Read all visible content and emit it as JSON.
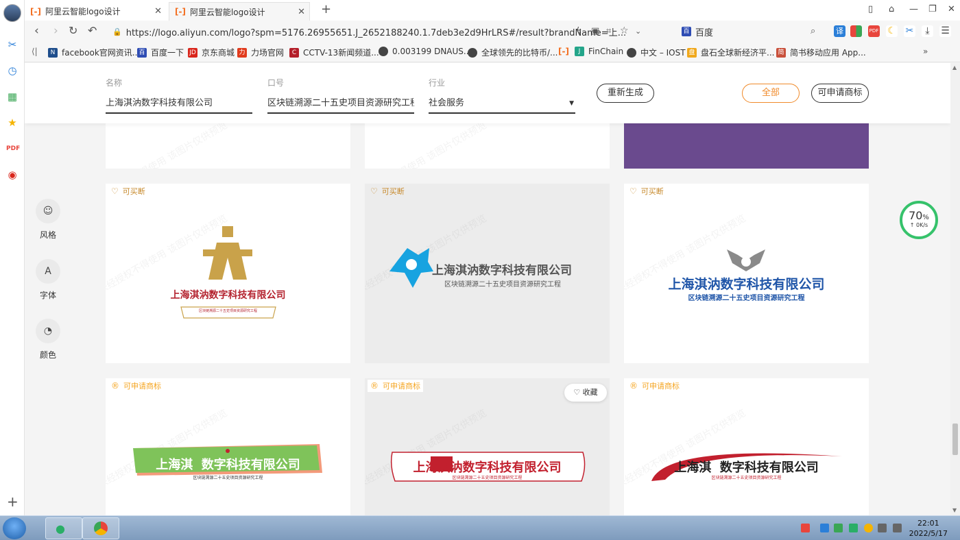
{
  "browser": {
    "tabs": [
      {
        "icon": "[-]",
        "title": "阿里云智能logo设计",
        "active": false
      },
      {
        "icon": "[-]",
        "title": "阿里云智能logo设计",
        "active": true
      }
    ],
    "url": "https://logo.aliyun.com/logo?spm=5176.26955651.J_2652188240.1.7deb3e2d9HrLRS#/result?brandName=上...",
    "search_engine": "百度",
    "bookmarks": [
      {
        "label": "facebook官网资讯...",
        "color": "#1f4e8c",
        "glyph": "N"
      },
      {
        "label": "百度一下",
        "color": "#2f4db4",
        "glyph": "百"
      },
      {
        "label": "京东商城",
        "color": "#d9261c",
        "glyph": "JD"
      },
      {
        "label": "力场官网",
        "color": "#e13b1d",
        "glyph": "力"
      },
      {
        "label": "CCTV-13新闻频道...",
        "color": "#b41f2a",
        "glyph": "C"
      },
      {
        "label": "0.003199 DNAUS...",
        "color": "#444444",
        "glyph": "●"
      },
      {
        "label": "全球领先的比特币/...",
        "color": "#444444",
        "glyph": "●"
      },
      {
        "label": "",
        "color": "#f36f21",
        "glyph": "[-]"
      },
      {
        "label": "FinChain",
        "color": "#24a58a",
        "glyph": "J"
      },
      {
        "label": "中文 – IOST",
        "color": "#444444",
        "glyph": "●"
      },
      {
        "label": "盘石全球新经济平...",
        "color": "#f0a81c",
        "glyph": "盘"
      },
      {
        "label": "简书移动应用 App...",
        "color": "#c9513c",
        "glyph": "简"
      }
    ]
  },
  "form": {
    "name_label": "名称",
    "name_value": "上海淇汭数字科技有限公司",
    "slogan_label": "口号",
    "slogan_value": "区块链溯源二十五史项目资源研究工程",
    "industry_label": "行业",
    "industry_value": "社会服务",
    "regenerate_label": "重新生成",
    "all_label": "全部",
    "registrable_label": "可申请商标"
  },
  "tools": [
    {
      "label": "风格",
      "glyph": "☺"
    },
    {
      "label": "字体",
      "glyph": "A"
    },
    {
      "label": "颜色",
      "glyph": "◔"
    }
  ],
  "badges": {
    "buyout": "可买断",
    "trademark": "可申请商标"
  },
  "favorite_label": "收藏",
  "watermark": "未经授权不得使用 该图片仅供预览",
  "logos": {
    "company": "上海淇汭数字科技有限公司",
    "slogan": "区块链溯源二十五史项目资源研究工程",
    "company_gap": "上海淇  数字科技有限公司",
    "colors": {
      "red": "#b4232f",
      "blue": "#1f55a8",
      "cyan": "#17a3e0",
      "gold": "#c9a24a",
      "green": "#7fc35a",
      "salmon": "#f39a7a",
      "darkred": "#c2202e"
    }
  },
  "speed_widget": {
    "percent": "70",
    "unit": "%",
    "rate": "↑ 0K/s"
  },
  "taskbar": {
    "time": "22:01",
    "date": "2022/5/17"
  }
}
